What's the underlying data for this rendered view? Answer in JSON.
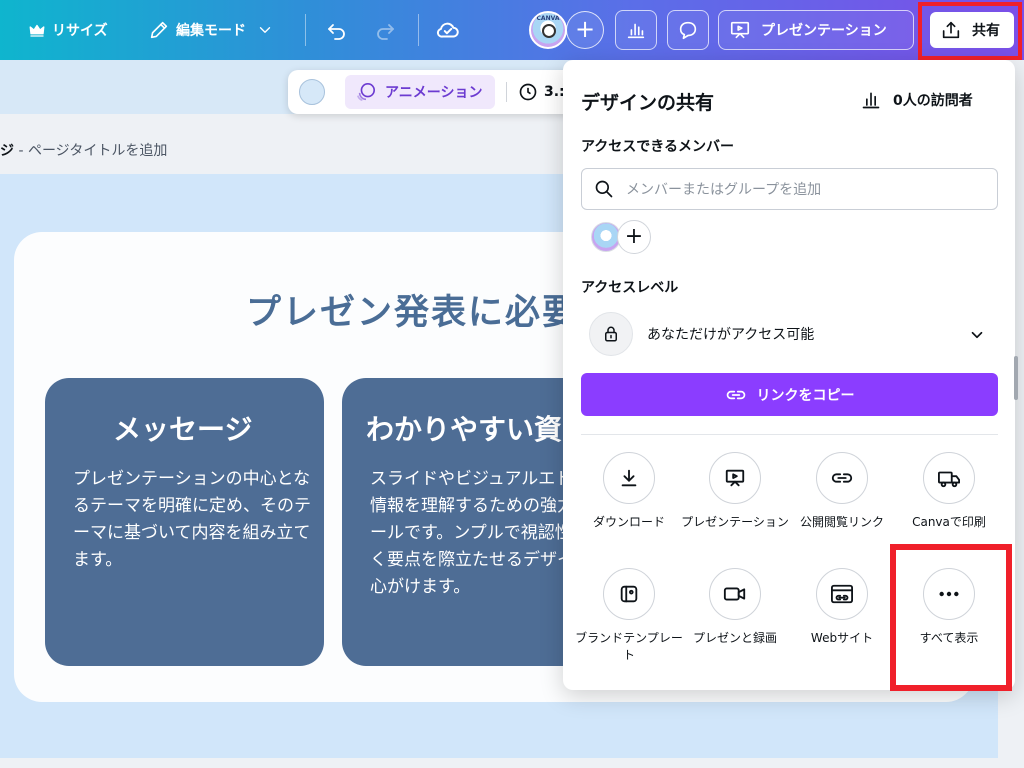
{
  "topbar": {
    "resize_label": "リサイズ",
    "edit_mode_label": "編集モード",
    "avatar_badge": "CANVA",
    "present_label": "プレゼンテーション",
    "share_label": "共有"
  },
  "float_toolbar": {
    "animation_label": "アニメーション",
    "timing_value": "3.:"
  },
  "page": {
    "title_prefix": "ジ",
    "title_placeholder": " - ページタイトルを追加"
  },
  "slide": {
    "title": "プレゼン発表に必要",
    "box1": {
      "heading": "メッセージ",
      "body": "プレゼンテーションの中心となるテーマを明確に定め、そのテーマに基づいて内容を組み立てます。"
    },
    "box2": {
      "heading": "わかりやすい資",
      "body": "スライドやビジュアルエドは、情報を理解するための強力なツールです。ンプルで視認性が高く要点を際立たせるデザインを心がけます。"
    }
  },
  "share_panel": {
    "title": "デザインの共有",
    "visitors": "0人の訪問者",
    "members_label": "アクセスできるメンバー",
    "search_placeholder": "メンバーまたはグループを追加",
    "access_level_label": "アクセスレベル",
    "access_level_value": "あなただけがアクセス可能",
    "copy_link_label": "リンクをコピー",
    "actions": [
      {
        "label": "ダウンロード",
        "icon": "download-icon"
      },
      {
        "label": "プレゼンテーション",
        "icon": "present-icon"
      },
      {
        "label": "公開閲覧リンク",
        "icon": "link-icon"
      },
      {
        "label": "Canvaで印刷",
        "icon": "truck-icon"
      },
      {
        "label": "ブランドテンプレート",
        "icon": "template-icon"
      },
      {
        "label": "プレゼンと録画",
        "icon": "video-icon"
      },
      {
        "label": "Webサイト",
        "icon": "website-icon"
      },
      {
        "label": "すべて表示",
        "icon": "more-icon"
      }
    ]
  },
  "colors": {
    "accent_purple": "#8b3dff",
    "highlight_red": "#f0202a",
    "slide_box": "#4e6d95",
    "slide_title": "#4a6d96",
    "slide_bg": "#d1e6fa"
  }
}
